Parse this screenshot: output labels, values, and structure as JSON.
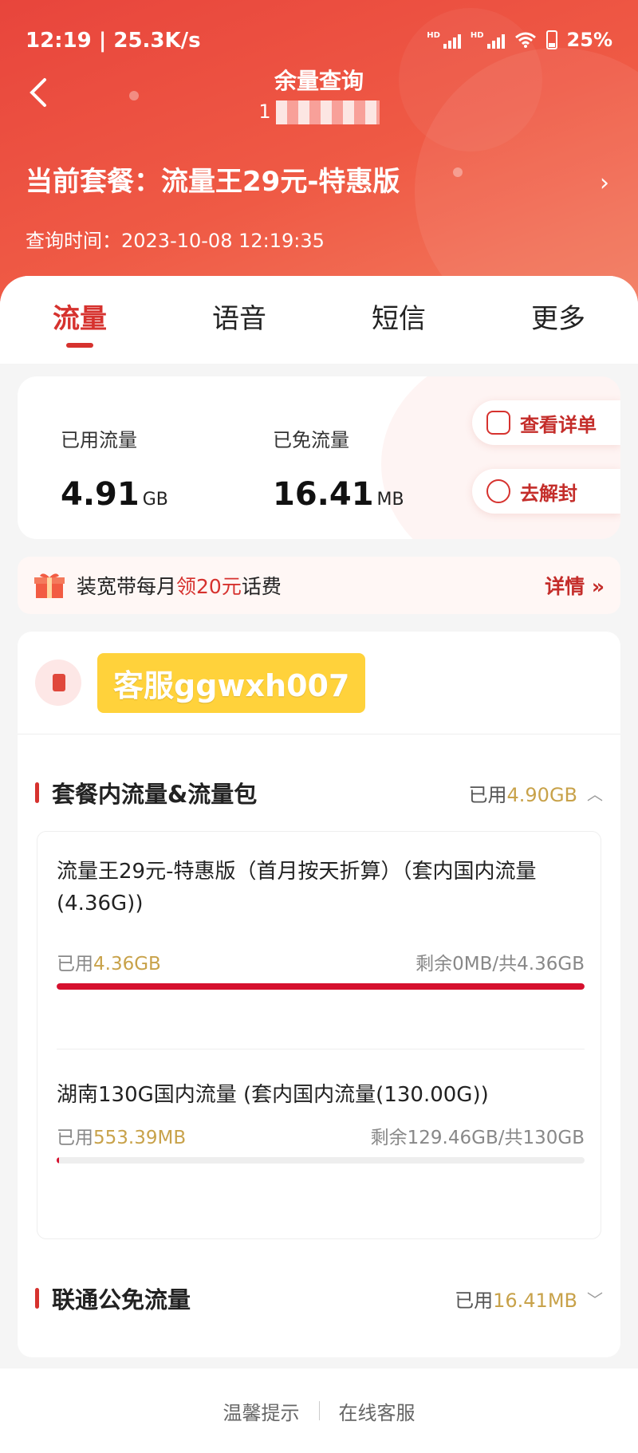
{
  "status_bar": {
    "time_speed": "12:19 | 25.3K/s",
    "battery": "25%",
    "signal_label": "HD"
  },
  "header": {
    "title": "余量查询",
    "phone_prefix": "1"
  },
  "plan": {
    "label": "当前套餐：流量王29元-特惠版",
    "query_time": "查询时间：2023-10-08 12:19:35"
  },
  "tabs": [
    {
      "label": "流量"
    },
    {
      "label": "语音"
    },
    {
      "label": "短信"
    },
    {
      "label": "更多"
    }
  ],
  "usage": {
    "used_label": "已用流量",
    "used_value": "4.91",
    "used_unit": "GB",
    "free_label": "已免流量",
    "free_value": "16.41",
    "free_unit": "MB",
    "detail_button": "查看详单",
    "unblock_button": "去解封"
  },
  "promo": {
    "text_before": "装宽带每月",
    "highlight": "领20元",
    "text_after": "话费",
    "more": "详情 »"
  },
  "account": {
    "watermark": "客服ggwxh007"
  },
  "section1": {
    "title": "套餐内流量&流量包",
    "used_prefix": "已用",
    "used_value": "4.90GB",
    "items": [
      {
        "name": "流量王29元-特惠版（首月按天折算）（套内国内流量(4.36G))",
        "used_prefix": "已用",
        "used_value": "4.36GB",
        "remain": "剩余0MB/共4.36GB",
        "progress": 1.0
      },
      {
        "name": "湖南130G国内流量 (套内国内流量(130.00G))",
        "used_prefix": "已用",
        "used_value": "553.39MB",
        "remain": "剩余129.46GB/共130GB",
        "progress": 0.004
      }
    ]
  },
  "section2": {
    "title": "联通公免流量",
    "used_prefix": "已用",
    "used_value": "16.41MB"
  },
  "footer": {
    "tips": "温馨提示",
    "service": "在线客服"
  },
  "colors": {
    "brand_red": "#d6322e",
    "hero_gradient_start": "#e8453c",
    "gold": "#c8a24a",
    "watermark_yellow": "#ffd23b"
  }
}
